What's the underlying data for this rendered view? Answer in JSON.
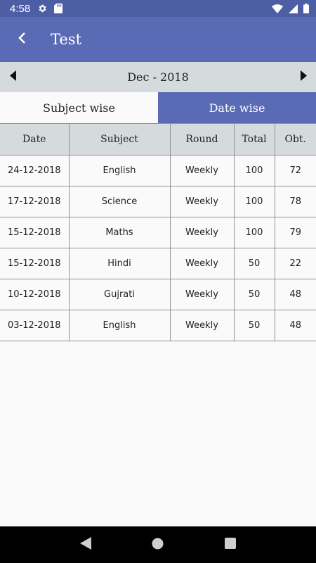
{
  "status_bar": {
    "time": "4:58",
    "icons": [
      "settings-icon",
      "sd-card-icon",
      "wifi-icon",
      "signal-icon",
      "battery-icon"
    ]
  },
  "app_bar": {
    "title": "Test",
    "color": "#5a6bb6"
  },
  "month_selector": {
    "label": "Dec - 2018"
  },
  "tabs": [
    {
      "label": "Subject wise",
      "active": false
    },
    {
      "label": "Date wise",
      "active": true
    }
  ],
  "table": {
    "headers": [
      "Date",
      "Subject",
      "Round",
      "Total",
      "Obt."
    ],
    "rows": [
      [
        "24-12-2018",
        "English",
        "Weekly",
        "100",
        "72"
      ],
      [
        "17-12-2018",
        "Science",
        "Weekly",
        "100",
        "78"
      ],
      [
        "15-12-2018",
        "Maths",
        "Weekly",
        "100",
        "79"
      ],
      [
        "15-12-2018",
        "Hindi",
        "Weekly",
        "50",
        "22"
      ],
      [
        "10-12-2018",
        "Gujrati",
        "Weekly",
        "50",
        "48"
      ],
      [
        "03-12-2018",
        "English",
        "Weekly",
        "50",
        "48"
      ]
    ]
  }
}
